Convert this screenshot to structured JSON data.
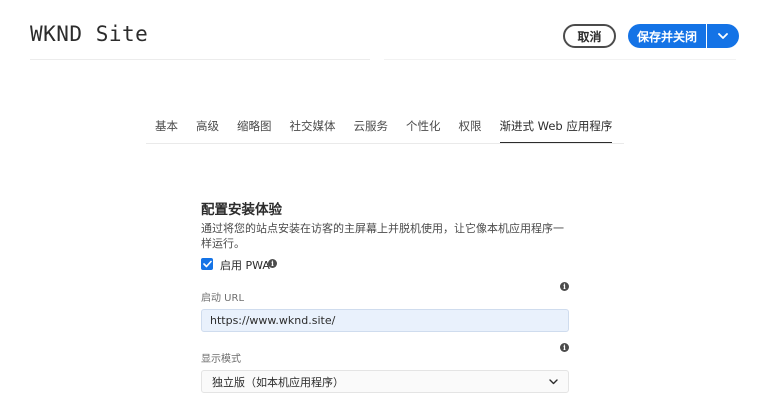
{
  "header": {
    "title": "WKND Site",
    "cancel_label": "取消",
    "primary_label": "保存并关闭"
  },
  "tabs": [
    {
      "label": "基本",
      "active": false
    },
    {
      "label": "高级",
      "active": false
    },
    {
      "label": "缩略图",
      "active": false
    },
    {
      "label": "社交媒体",
      "active": false
    },
    {
      "label": "云服务",
      "active": false
    },
    {
      "label": "个性化",
      "active": false
    },
    {
      "label": "权限",
      "active": false
    },
    {
      "label": "渐进式 Web 应用程序",
      "active": true
    }
  ],
  "section": {
    "heading": "配置安装体验",
    "description": "通过将您的站点安装在访客的主屏幕上并脱机使用，让它像本机应用程序一样运行。"
  },
  "pwa": {
    "checkbox_label": "启用 PWA",
    "checked": true
  },
  "start_url": {
    "label": "启动 URL",
    "value": "https://www.wknd.site/"
  },
  "display_mode": {
    "label": "显示模式",
    "value": "独立版（如本机应用程序）"
  },
  "colors": {
    "accent": "#1473e6",
    "text": "#2c2c2c",
    "input_bg": "#e9f1fc"
  },
  "icons": [
    "chevron-down-icon",
    "info-icon",
    "checkmark-icon"
  ]
}
